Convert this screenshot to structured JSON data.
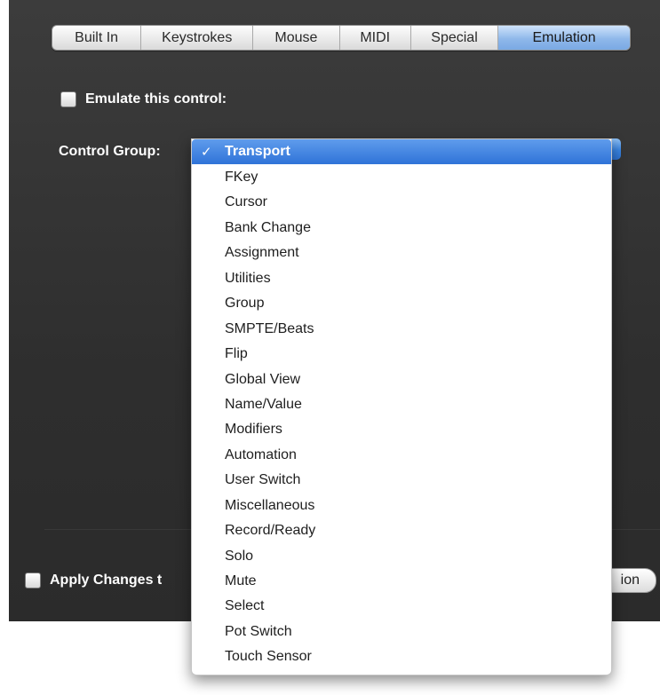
{
  "tabs": [
    {
      "label": "Built In"
    },
    {
      "label": "Keystrokes"
    },
    {
      "label": "Mouse"
    },
    {
      "label": "MIDI"
    },
    {
      "label": "Special"
    },
    {
      "label": "Emulation"
    }
  ],
  "active_tab": "Emulation",
  "emulate_checkbox": {
    "label": "Emulate this control:",
    "checked": false
  },
  "control_group": {
    "label": "Control Group:",
    "selected": "Transport",
    "check_mark": "✓",
    "options": [
      "Transport",
      "FKey",
      "Cursor",
      "Bank Change",
      "Assignment",
      "Utilities",
      "Group",
      "SMPTE/Beats",
      "Flip",
      "Global View",
      "Name/Value",
      "Modifiers",
      "Automation",
      "User Switch",
      "Miscellaneous",
      "Record/Ready",
      "Solo",
      "Mute",
      "Select",
      "Pot Switch",
      "Touch Sensor"
    ]
  },
  "apply_checkbox": {
    "label": "Apply Changes t",
    "checked": false
  },
  "right_button_label": "ion",
  "colors": {
    "panel": "#2e2e2e",
    "accent": "#3a85e2",
    "menu_bg": "#ffffff"
  }
}
